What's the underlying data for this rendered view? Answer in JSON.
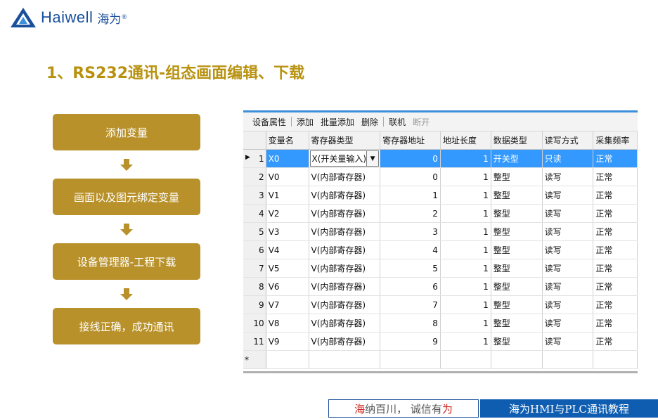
{
  "logo": {
    "brand": "Haiwell",
    "brand_cn": "海为",
    "reg": "®"
  },
  "title": "1、RS232通讯-组态画面编辑、下载",
  "flow": [
    "添加变量",
    "画面以及图元绑定变量",
    "设备管理器-工程下载",
    "接线正确，成功通讯"
  ],
  "toolbar": {
    "device_props": "设备属性",
    "add": "添加",
    "batch_add": "批量添加",
    "delete": "删除",
    "connect": "联机",
    "disconnect": "断开"
  },
  "grid": {
    "headers": [
      "变量名",
      "寄存器类型",
      "寄存器地址",
      "地址长度",
      "数据类型",
      "读写方式",
      "采集频率"
    ],
    "rows": [
      {
        "n": "1",
        "name": "X0",
        "reg": "X(开关量输入)",
        "addr": "0",
        "len": "1",
        "type": "开关型",
        "rw": "只读",
        "freq": "正常"
      },
      {
        "n": "2",
        "name": "V0",
        "reg": "V(内部寄存器)",
        "addr": "0",
        "len": "1",
        "type": "整型",
        "rw": "读写",
        "freq": "正常"
      },
      {
        "n": "3",
        "name": "V1",
        "reg": "V(内部寄存器)",
        "addr": "1",
        "len": "1",
        "type": "整型",
        "rw": "读写",
        "freq": "正常"
      },
      {
        "n": "4",
        "name": "V2",
        "reg": "V(内部寄存器)",
        "addr": "2",
        "len": "1",
        "type": "整型",
        "rw": "读写",
        "freq": "正常"
      },
      {
        "n": "5",
        "name": "V3",
        "reg": "V(内部寄存器)",
        "addr": "3",
        "len": "1",
        "type": "整型",
        "rw": "读写",
        "freq": "正常"
      },
      {
        "n": "6",
        "name": "V4",
        "reg": "V(内部寄存器)",
        "addr": "4",
        "len": "1",
        "type": "整型",
        "rw": "读写",
        "freq": "正常"
      },
      {
        "n": "7",
        "name": "V5",
        "reg": "V(内部寄存器)",
        "addr": "5",
        "len": "1",
        "type": "整型",
        "rw": "读写",
        "freq": "正常"
      },
      {
        "n": "8",
        "name": "V6",
        "reg": "V(内部寄存器)",
        "addr": "6",
        "len": "1",
        "type": "整型",
        "rw": "读写",
        "freq": "正常"
      },
      {
        "n": "9",
        "name": "V7",
        "reg": "V(内部寄存器)",
        "addr": "7",
        "len": "1",
        "type": "整型",
        "rw": "读写",
        "freq": "正常"
      },
      {
        "n": "10",
        "name": "V8",
        "reg": "V(内部寄存器)",
        "addr": "8",
        "len": "1",
        "type": "整型",
        "rw": "读写",
        "freq": "正常"
      },
      {
        "n": "11",
        "name": "V9",
        "reg": "V(内部寄存器)",
        "addr": "9",
        "len": "1",
        "type": "整型",
        "rw": "读写",
        "freq": "正常"
      }
    ],
    "new_row_marker": "*",
    "current_row_marker": "▶"
  },
  "footer": {
    "slogan_1": "海",
    "slogan_2": "纳百川， 诚信有",
    "slogan_3": "为",
    "course": "海为HMI与PLC通讯教程"
  },
  "colors": {
    "accent_gold": "#b8912a",
    "title_gold": "#b8920f",
    "brand_blue": "#1a4f9c",
    "selection_blue": "#3399ff",
    "footer_blue": "#0f5db0"
  }
}
